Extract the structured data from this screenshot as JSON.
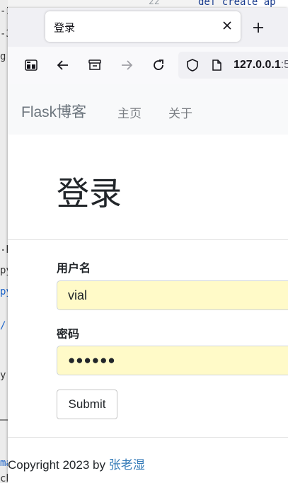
{
  "background_editor": {
    "line_number": "22",
    "code_line": "def create ap",
    "left_glyphs": [
      {
        "text": "-1",
        "blue": false
      },
      {
        "text": "-3",
        "blue": false
      },
      {
        "text": "g",
        "blue": false
      },
      {
        "text": ".p",
        "blue": false
      },
      {
        "text": "py",
        "blue": false
      },
      {
        "text": "py",
        "blue": true
      },
      {
        "text": "/",
        "blue": true
      },
      {
        "text": "y",
        "blue": false
      },
      {
        "text": "ma",
        "blue": true
      },
      {
        "text": "ch",
        "blue": false
      }
    ]
  },
  "browser": {
    "tab": {
      "title": "登录",
      "close_icon": "close-icon"
    },
    "new_tab_icon": "plus-icon",
    "toolbar": {
      "icons": [
        "sidebar-icon",
        "back-arrow-icon",
        "save-to-pocket-icon",
        "forward-arrow-icon",
        "reload-icon"
      ],
      "url_host": "127.0.0.1",
      "url_rest": ":5",
      "shield_icon": "shield-icon",
      "page_icon": "page-icon"
    }
  },
  "page": {
    "navbar": {
      "brand": "Flask博客",
      "links": [
        "主页",
        "关于"
      ]
    },
    "title": "登录",
    "form": {
      "username_label": "用户名",
      "username_value": "vial",
      "password_label": "密码",
      "password_mask": "●●●●●●",
      "submit_label": "Submit"
    },
    "footer": {
      "text": "Copyright 2023 by ",
      "author": "张老湿"
    },
    "colors": {
      "autofill": "#fffac8",
      "link": "#337ab7",
      "navbar_bg": "#f8f9fa"
    }
  }
}
